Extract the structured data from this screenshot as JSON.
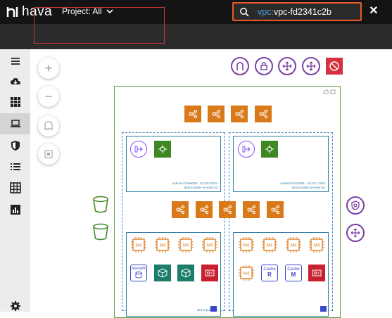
{
  "app": {
    "logo_text": "hava"
  },
  "header": {
    "project_label": "Project: All"
  },
  "search": {
    "prefix": "vpc:",
    "value": "vpc-fd2341c2b"
  },
  "sidebar": {
    "items": [
      {
        "name": "menu",
        "icon": "hamburger-icon"
      },
      {
        "name": "import",
        "icon": "cloud-download-icon"
      },
      {
        "name": "apps",
        "icon": "grid-icon"
      },
      {
        "name": "environments",
        "icon": "laptop-icon"
      },
      {
        "name": "security",
        "icon": "shield-icon"
      },
      {
        "name": "list",
        "icon": "list-icon"
      },
      {
        "name": "table",
        "icon": "table-icon"
      },
      {
        "name": "reports",
        "icon": "bar-chart-icon"
      },
      {
        "name": "settings",
        "icon": "gear-icon"
      }
    ]
  },
  "subnets": {
    "a": {
      "label_line1": "subnet-27ea8009 - 10.23.0.0/24",
      "label_line2": "demo-public-us-east-1d"
    },
    "b": {
      "label_line1": "subnet-b10c2001 - 10.23.1.0/24",
      "label_line2": "demo-public-us-east-1e"
    },
    "c": {
      "label_line1": "demo-pub-sub",
      "label_line2": ""
    }
  },
  "chips": {
    "m4": "M4"
  },
  "caches": {
    "r": "R",
    "m": "M",
    "cache_label": "Cache"
  },
  "db": {
    "mariadb": "MariaDB"
  },
  "colors": {
    "accent": "#e85a2a",
    "vpc_border": "#5aa03c",
    "subnet_border": "#2f7fa8",
    "compute": "#d9791a"
  }
}
